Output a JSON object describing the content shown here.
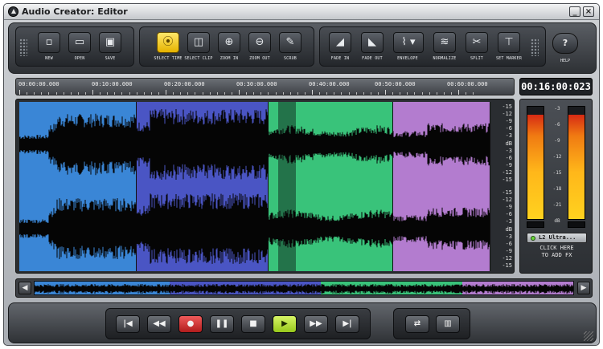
{
  "window": {
    "title": "Audio Creator: Editor",
    "minimize_glyph": "_",
    "close_glyph": "×"
  },
  "toolbar": {
    "file_buttons": [
      {
        "label": "NEW",
        "icon": "new-file-icon",
        "glyph": "▫"
      },
      {
        "label": "OPEN",
        "icon": "open-folder-icon",
        "glyph": "▭"
      },
      {
        "label": "SAVE",
        "icon": "save-disk-icon",
        "glyph": "▣"
      }
    ],
    "view_buttons": [
      {
        "label": "SELECT TIME",
        "icon": "select-time-icon",
        "glyph": "⦿",
        "active": true
      },
      {
        "label": "SELECT CLIP",
        "icon": "select-clip-icon",
        "glyph": "◫"
      },
      {
        "label": "ZOOM IN",
        "icon": "zoom-in-icon",
        "glyph": "⊕"
      },
      {
        "label": "ZOOM OUT",
        "icon": "zoom-out-icon",
        "glyph": "⊖"
      },
      {
        "label": "SCRUB",
        "icon": "scrub-icon",
        "glyph": "✎"
      }
    ],
    "edit_buttons": [
      {
        "label": "FADE IN",
        "icon": "fade-in-icon",
        "glyph": "◢"
      },
      {
        "label": "FADE OUT",
        "icon": "fade-out-icon",
        "glyph": "◣"
      },
      {
        "label": "ENVELOPE",
        "icon": "envelope-icon",
        "glyph": "⌇ ▾"
      },
      {
        "label": "NORMALIZE",
        "icon": "normalize-icon",
        "glyph": "≋"
      },
      {
        "label": "SPLIT",
        "icon": "split-icon",
        "glyph": "✂"
      },
      {
        "label": "SET MARKER",
        "icon": "set-marker-icon",
        "glyph": "⊤"
      }
    ],
    "help": {
      "label": "HELP",
      "glyph": "?"
    }
  },
  "timeline": {
    "ticks": [
      "00:00:00.000",
      "00:10:00.000",
      "00:20:00.000",
      "00:30:00.000",
      "00:40:00.000",
      "00:50:00.000",
      "00:60:00.000"
    ],
    "current_time": "00:16:00:023"
  },
  "waveform": {
    "clips": [
      {
        "color": "#3a86d6",
        "dark": "#2a6db8"
      },
      {
        "color": "#4a55c4",
        "dark": "#3a44a8"
      },
      {
        "color": "#39c37a",
        "dark": "#2a9a5e",
        "band": "#23734a"
      },
      {
        "color": "#b37ccf",
        "dark": "#9a63b6"
      }
    ],
    "db_labels": [
      "-15",
      "-12",
      "-9",
      "-6",
      "-3",
      "dB",
      "-3",
      "-6",
      "-9",
      "-12",
      "-15"
    ]
  },
  "meter": {
    "scale": [
      "-3",
      "-6",
      "-9",
      "-12",
      "-15",
      "-18",
      "-21",
      "dB"
    ],
    "left_level": 0.93,
    "right_level": 0.93,
    "fx_name": "L2 Ultra...",
    "fx_add_line1": "CLICK HERE",
    "fx_add_line2": "TO ADD FX"
  },
  "overview": {
    "left_glyph": "◀",
    "right_glyph": "▶"
  },
  "transport": {
    "buttons": [
      {
        "name": "go-to-start",
        "glyph": "|◀"
      },
      {
        "name": "rewind",
        "glyph": "◀◀"
      },
      {
        "name": "record",
        "glyph": "●"
      },
      {
        "name": "pause",
        "glyph": "❚❚"
      },
      {
        "name": "stop",
        "glyph": "■"
      },
      {
        "name": "play",
        "glyph": "▶"
      },
      {
        "name": "fast-forward",
        "glyph": "▶▶"
      },
      {
        "name": "go-to-end",
        "glyph": "▶|"
      }
    ],
    "extra_buttons": [
      {
        "name": "loop",
        "glyph": "⇄"
      },
      {
        "name": "mixer",
        "glyph": "▥"
      }
    ]
  }
}
